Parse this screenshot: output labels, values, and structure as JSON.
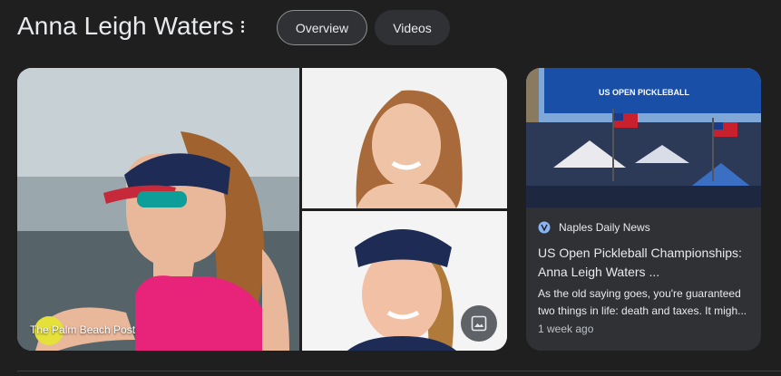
{
  "header": {
    "title": "Anna Leigh Waters",
    "more_icon": "more-vert-icon",
    "tabs": [
      {
        "label": "Overview",
        "selected": true
      },
      {
        "label": "Videos",
        "selected": false
      }
    ]
  },
  "gallery": {
    "main_image_caption": "The Palm Beach Post",
    "image_search_icon": "image-icon"
  },
  "news_card": {
    "source": "Naples Daily News",
    "source_icon": "newspaper-favicon-icon",
    "title": "US Open Pickleball Championships: Anna Leigh Waters ...",
    "snippet": "As the old saying goes, you're guaranteed two things in life: death and taxes. It migh...",
    "time": "1 week ago",
    "banner_text": "US OPEN PICKLEBALL"
  },
  "colors": {
    "background": "#1f1f1f",
    "card": "#303134",
    "text": "#e8eaed",
    "muted": "#bdc1c6",
    "accent_blue": "#8ab4f8"
  }
}
